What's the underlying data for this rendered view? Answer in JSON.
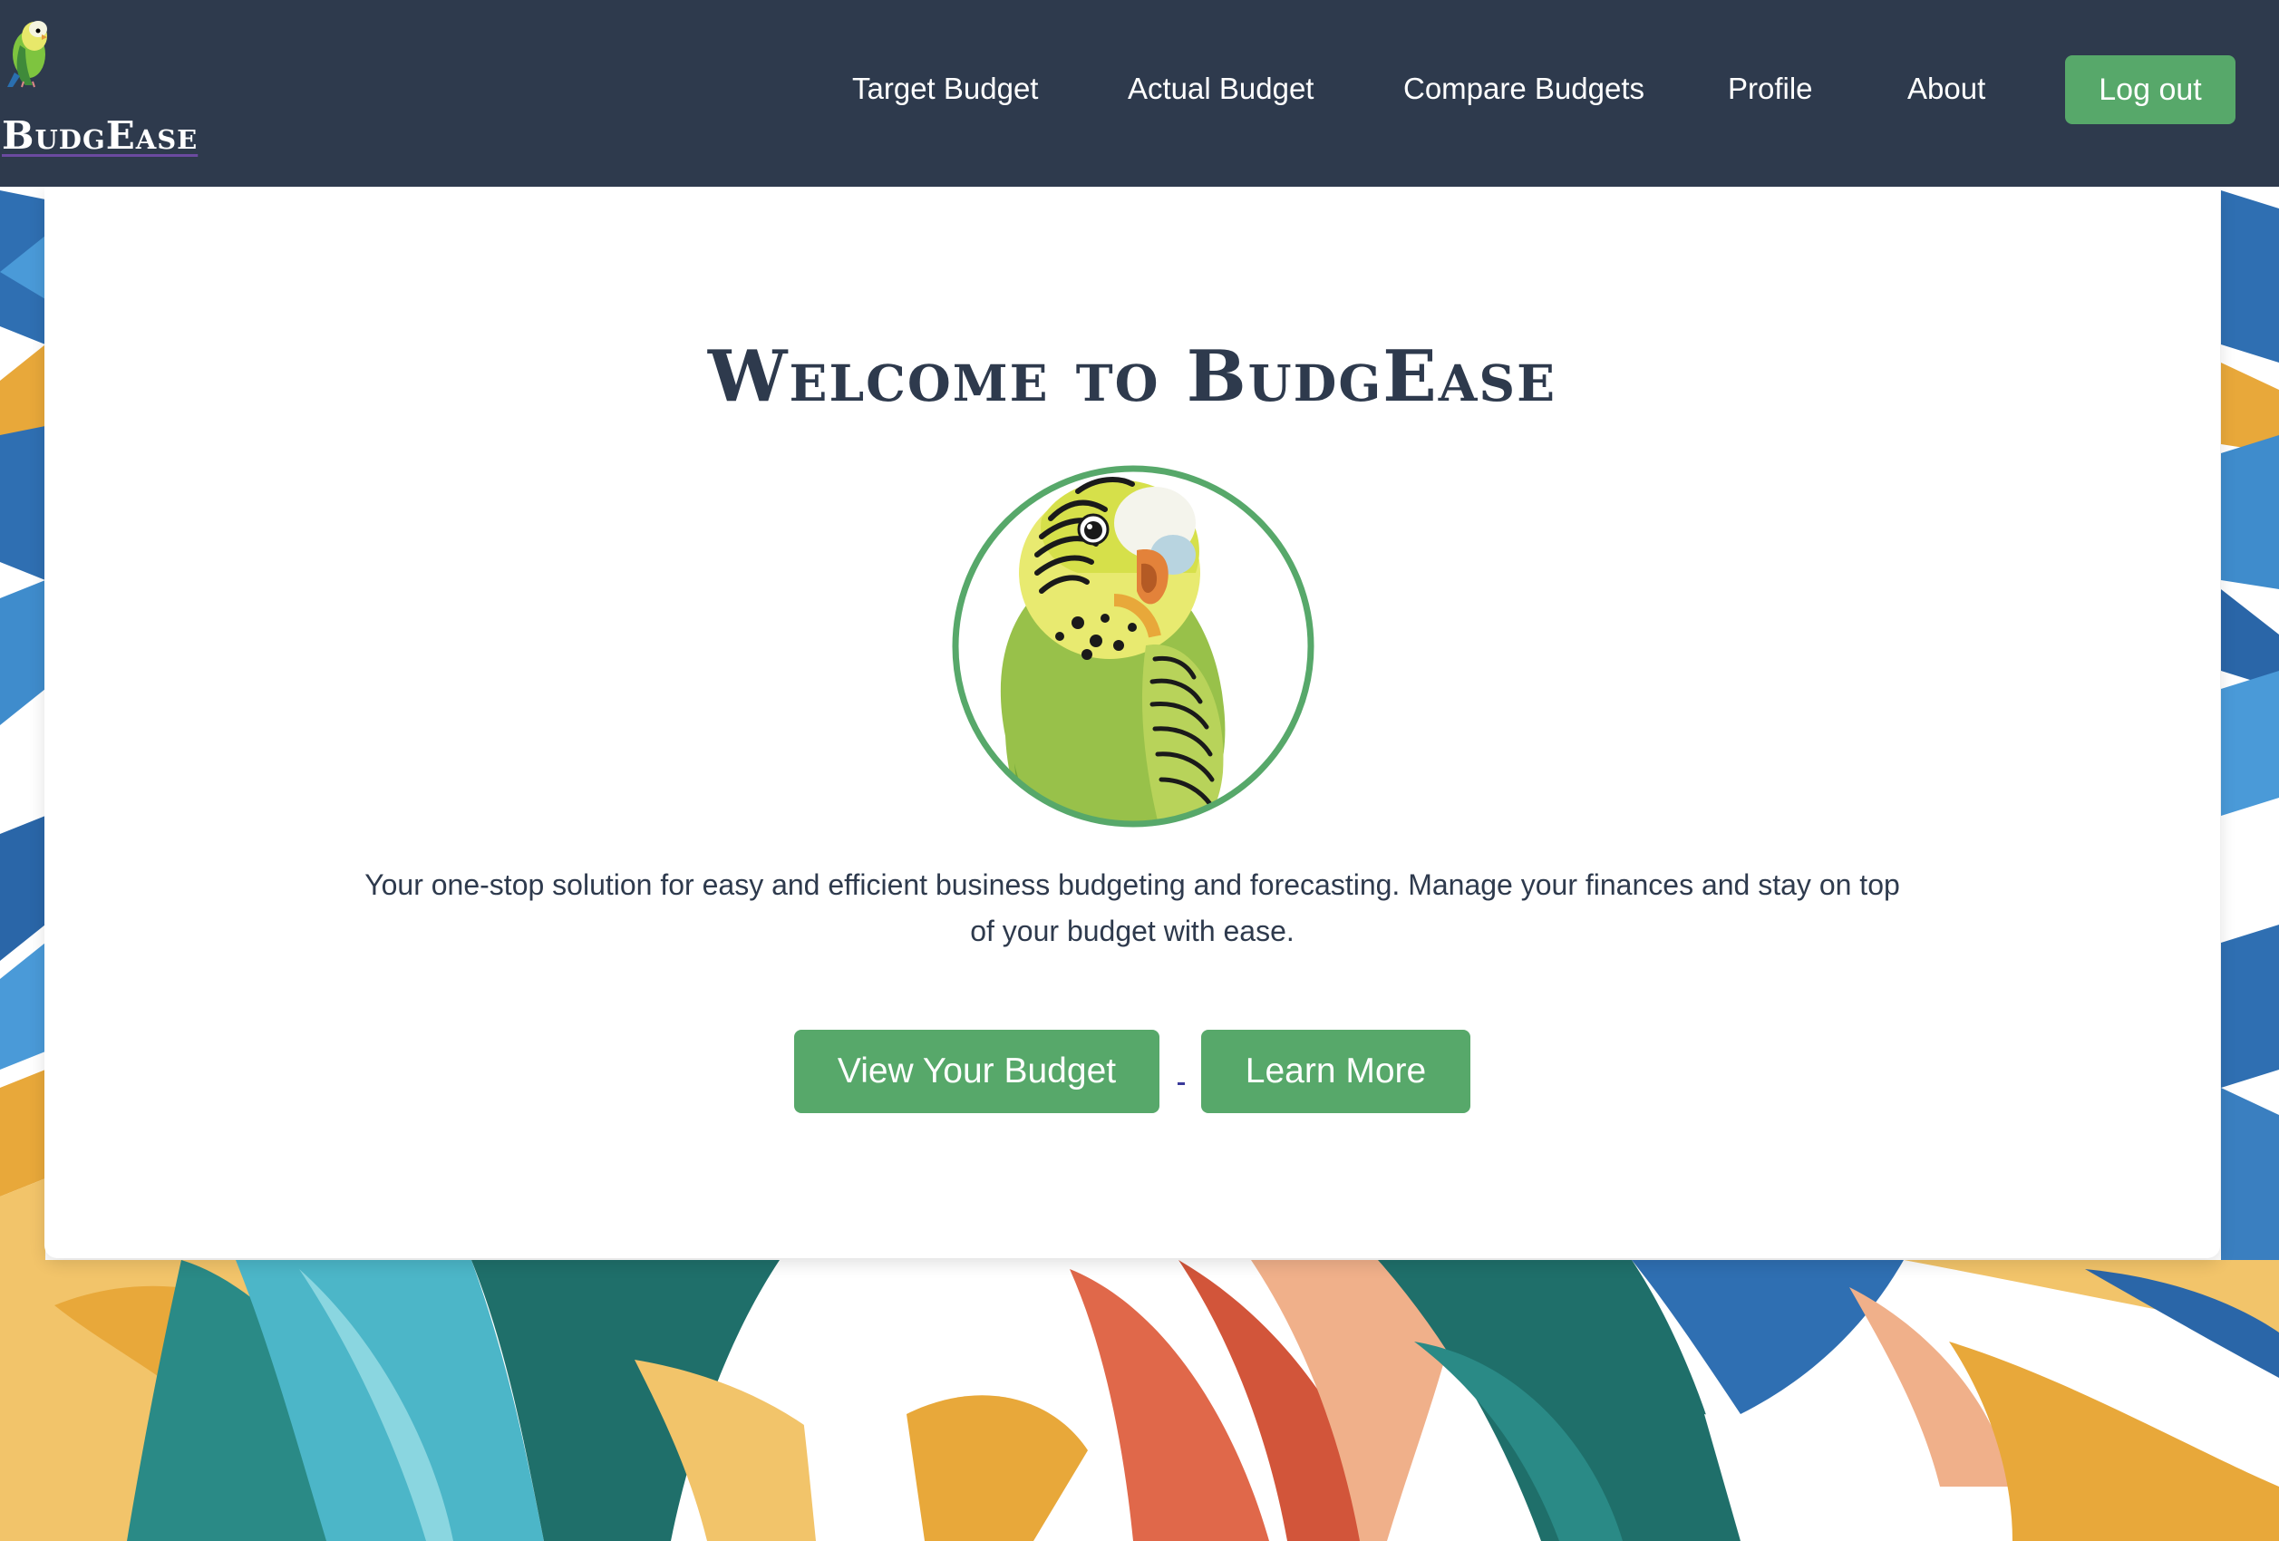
{
  "brand": {
    "name": "BudgEase",
    "logo_icon": "budgie-icon"
  },
  "nav": {
    "items": [
      {
        "label": "Target Budget"
      },
      {
        "label": "Actual Budget"
      },
      {
        "label": "Compare Budgets"
      },
      {
        "label": "Profile"
      },
      {
        "label": "About"
      }
    ],
    "logout_label": "Log out"
  },
  "hero": {
    "title": "Welcome to BudgEase",
    "avatar_icon": "budgie-avatar-icon",
    "tagline": "Your one-stop solution for easy and efficient business budgeting and forecasting. Manage your finances and stay on top of your budget with ease.",
    "primary_button": "View Your Budget",
    "secondary_button": "Learn More"
  },
  "colors": {
    "navbar": "#2e3a4d",
    "accent_green": "#57a86a",
    "text_dark": "#2e3a4d",
    "card_bg": "#ffffff"
  },
  "background": {
    "pattern": "tropical-leaves-pattern"
  }
}
